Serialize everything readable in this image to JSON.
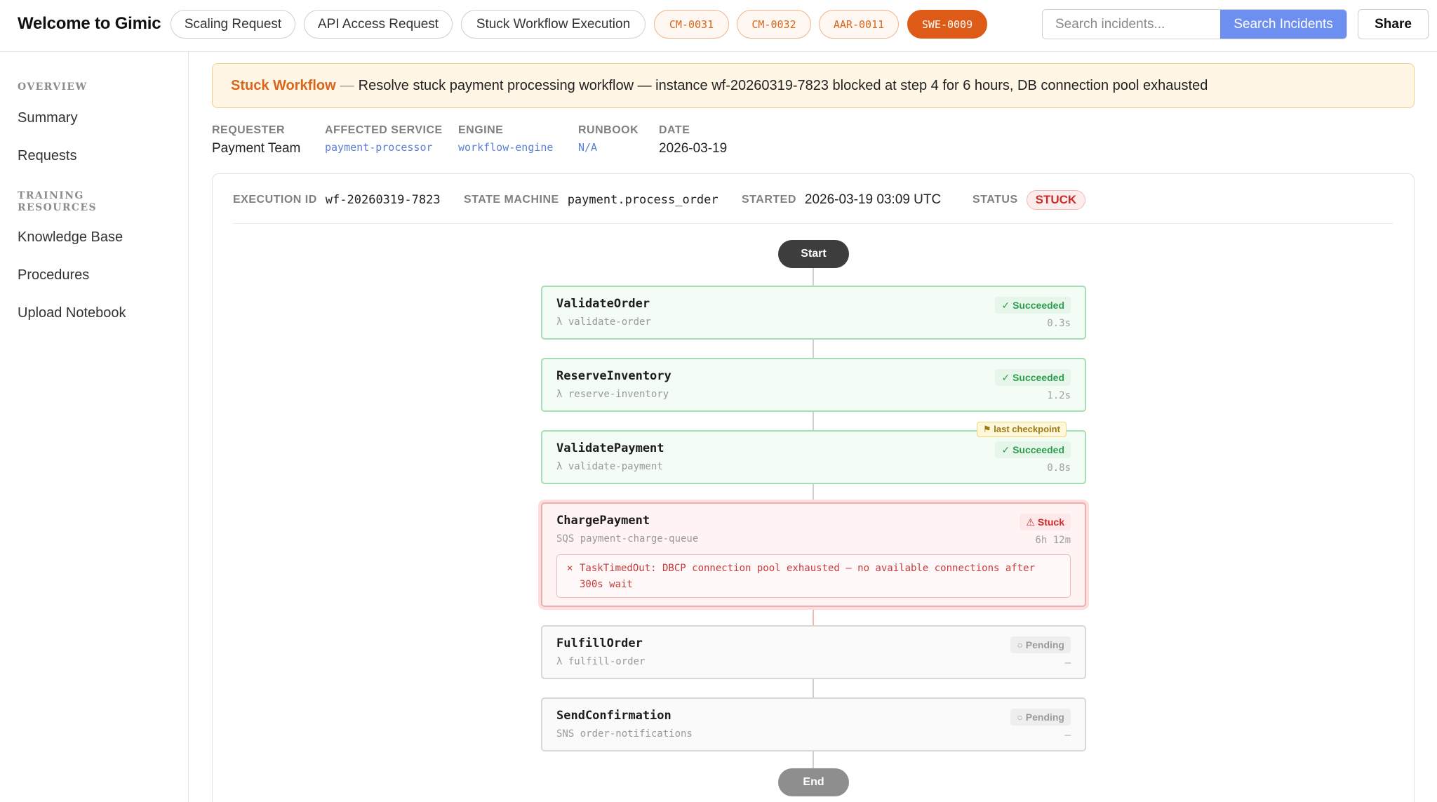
{
  "header": {
    "title": "Welcome to Gimic",
    "tabs": [
      "Scaling Request",
      "API Access Request",
      "Stuck Workflow Execution"
    ],
    "incidents": [
      "CM-0031",
      "CM-0032",
      "AAR-0011",
      "SWE-0009"
    ],
    "active_incident": "SWE-0009",
    "search_placeholder": "Search incidents...",
    "search_button": "Search Incidents",
    "share_button": "Share"
  },
  "sidebar": {
    "sections": [
      {
        "title": "OVERVIEW",
        "items": [
          "Summary",
          "Requests"
        ]
      },
      {
        "title": "TRAINING RESOURCES",
        "items": [
          "Knowledge Base",
          "Procedures",
          "Upload Notebook"
        ]
      }
    ]
  },
  "banner": {
    "label": "Stuck Workflow",
    "separator": "—",
    "text": "Resolve stuck payment processing workflow — instance wf-20260319-7823 blocked at step 4 for 6 hours, DB connection pool exhausted"
  },
  "meta": [
    {
      "label": "REQUESTER",
      "value": "Payment Team"
    },
    {
      "label": "AFFECTED SERVICE",
      "value": "payment-processor"
    },
    {
      "label": "ENGINE",
      "value": "workflow-engine"
    },
    {
      "label": "RUNBOOK",
      "value": "N/A"
    },
    {
      "label": "DATE",
      "value": "2026-03-19"
    }
  ],
  "execution": {
    "id_label": "EXECUTION ID",
    "id": "wf-20260319-7823",
    "sm_label": "STATE MACHINE",
    "state_machine": "payment.process_order",
    "started_label": "STARTED",
    "started": "2026-03-19 03:09 UTC",
    "status_label": "STATUS",
    "status": "STUCK"
  },
  "flow": {
    "start": "Start",
    "end": "End",
    "checkpoint": "⚑ last checkpoint",
    "steps": [
      {
        "name": "ValidateOrder",
        "sub": "λ validate-order",
        "status": "✓ Succeeded",
        "time": "0.3s"
      },
      {
        "name": "ReserveInventory",
        "sub": "λ reserve-inventory",
        "status": "✓ Succeeded",
        "time": "1.2s"
      },
      {
        "name": "ValidatePayment",
        "sub": "λ validate-payment",
        "status": "✓ Succeeded",
        "time": "0.8s"
      },
      {
        "name": "ChargePayment",
        "sub": "SQS payment-charge-queue",
        "status": "⚠ Stuck",
        "time": "6h 12m",
        "error_mark": "×",
        "error": "TaskTimedOut: DBCP connection pool exhausted — no available connections after 300s wait"
      },
      {
        "name": "FulfillOrder",
        "sub": "λ fulfill-order",
        "status": "○ Pending",
        "time": "—"
      },
      {
        "name": "SendConfirmation",
        "sub": "SNS order-notifications",
        "status": "○ Pending",
        "time": "—"
      }
    ]
  },
  "colors": {
    "accent": "#dd5a17",
    "search_button": "#6c8ff0",
    "success": "#2e9e4d",
    "stuck": "#cc2b2b"
  }
}
